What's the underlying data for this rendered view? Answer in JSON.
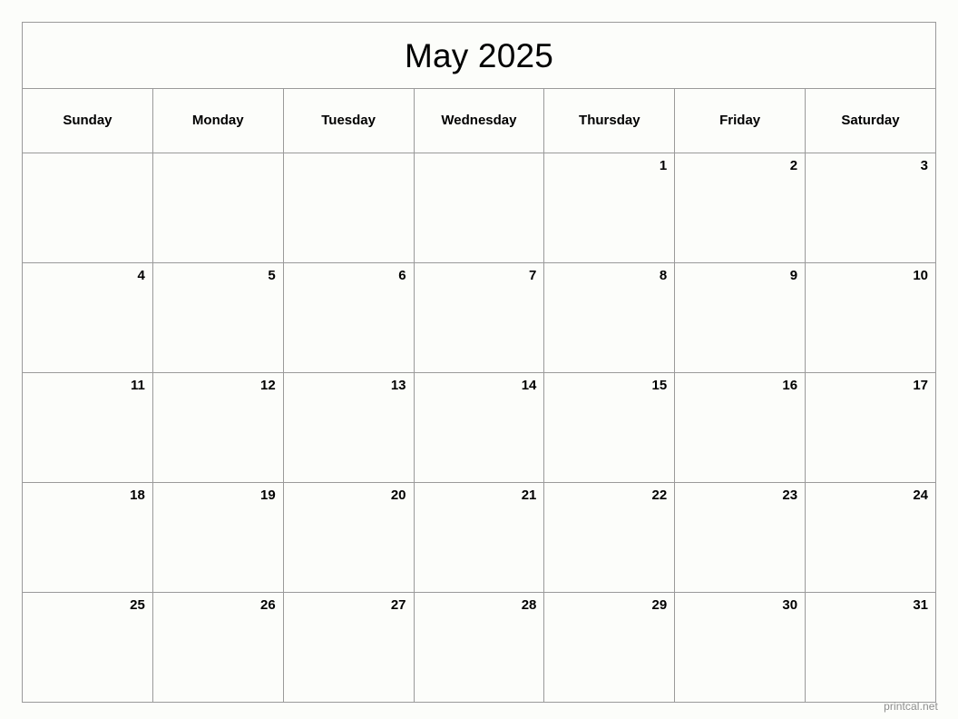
{
  "calendar": {
    "title": "May 2025",
    "weekdays": [
      "Sunday",
      "Monday",
      "Tuesday",
      "Wednesday",
      "Thursday",
      "Friday",
      "Saturday"
    ],
    "weeks": [
      [
        "",
        "",
        "",
        "",
        "1",
        "2",
        "3"
      ],
      [
        "4",
        "5",
        "6",
        "7",
        "8",
        "9",
        "10"
      ],
      [
        "11",
        "12",
        "13",
        "14",
        "15",
        "16",
        "17"
      ],
      [
        "18",
        "19",
        "20",
        "21",
        "22",
        "23",
        "24"
      ],
      [
        "25",
        "26",
        "27",
        "28",
        "29",
        "30",
        "31"
      ]
    ]
  },
  "footer": {
    "watermark": "printcal.net"
  },
  "colors": {
    "page_background": "#fcfdfa",
    "cell_background": "#fcfdfa",
    "grid_line": "#9a9a9a",
    "text": "#000000",
    "watermark_text": "#8d8d8d"
  }
}
